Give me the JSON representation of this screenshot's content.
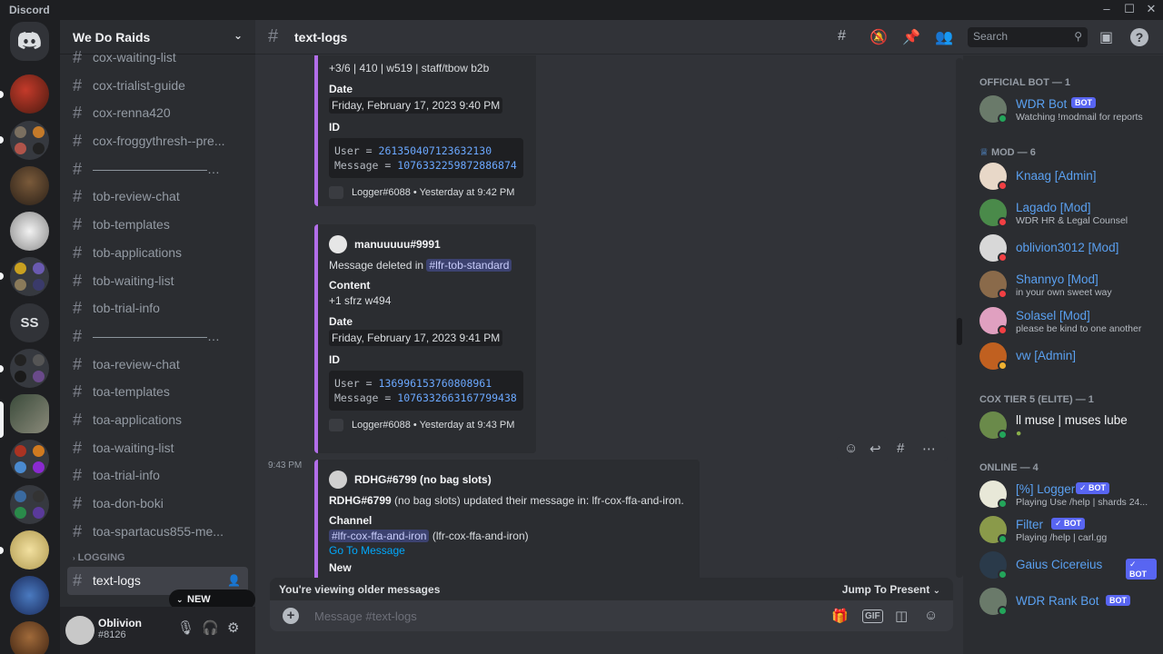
{
  "app": {
    "title": "Discord"
  },
  "server": {
    "name": "We Do Raids",
    "home_initials": "SS"
  },
  "channels": [
    "cox-waiting-list",
    "cox-trialist-guide",
    "cox-renna420",
    "cox-froggythresh--pre...",
    "——————————...",
    "tob-review-chat",
    "tob-templates",
    "tob-applications",
    "tob-waiting-list",
    "tob-trial-info",
    "——————————...",
    "toa-review-chat",
    "toa-templates",
    "toa-applications",
    "toa-waiting-list",
    "toa-trial-info",
    "toa-don-boki",
    "toa-spartacus855-me..."
  ],
  "category": "LOGGING",
  "active_channel": "text-logs",
  "new_unreads": "NEW UNREADS",
  "user": {
    "name": "Oblivion",
    "tag": "#8126"
  },
  "header": {
    "channel": "text-logs",
    "search_placeholder": "Search"
  },
  "messages": {
    "embed1": {
      "content": "+3/6 | 410 | w519 | staff/tbow b2b",
      "date_label": "Date",
      "date": "Friday, February 17, 2023 9:40 PM",
      "id_label": "ID",
      "user_key": "User",
      "user_id": "261350407123632130",
      "message_key": "Message",
      "message_id": "1076332259872886874",
      "footer": "Logger#6088 • Yesterday at 9:42 PM"
    },
    "embed2": {
      "author": "manuuuuu#9991",
      "deleted_prefix": "Message deleted in",
      "deleted_channel": "#lfr-tob-standard",
      "content_label": "Content",
      "content": "+1 sfrz w494",
      "date_label": "Date",
      "date": "Friday, February 17, 2023 9:41 PM",
      "id_label": "ID",
      "user_key": "User",
      "user_id": "136996153760808961",
      "message_key": "Message",
      "message_id": "1076332663167799438",
      "footer": "Logger#6088 • Yesterday at 9:43 PM"
    },
    "embed3": {
      "timestamp": "9:43 PM",
      "author": "RDHG#6799 (no bag slots)",
      "update_bold": "RDHG#6799",
      "update_text": "(no bag slots) updated their message in: lfr-cox-ffa-and-iron.",
      "channel_label": "Channel",
      "channel_mention": "#lfr-cox-ffa-and-iron",
      "channel_text": "(lfr-cox-ffa-and-iron)",
      "goto": "Go To Message",
      "new_label": "New"
    }
  },
  "older_bar": {
    "text": "You're viewing older messages",
    "jump": "Jump To Present"
  },
  "composer": {
    "placeholder": "Message #text-logs"
  },
  "members": {
    "official_bot_header": "OFFICIAL BOT — 1",
    "mod_header": "MOD — 6",
    "cox_header": "COX TIER 5 (ELITE) — 1",
    "online_header": "ONLINE — 4",
    "bot_badge": "BOT",
    "list": [
      {
        "name": "WDR Bot",
        "sub": "Watching !modmail for reports",
        "color": "#5aa0f0"
      },
      {
        "name": "Knaag [Admin]",
        "sub": "",
        "color": "#5aa0f0"
      },
      {
        "name": "Lagado [Mod]",
        "sub": "WDR HR & Legal Counsel",
        "color": "#5aa0f0"
      },
      {
        "name": "oblivion3012 [Mod]",
        "sub": "",
        "color": "#5aa0f0"
      },
      {
        "name": "Shannyo [Mod]",
        "sub": "in your own sweet way",
        "color": "#5aa0f0"
      },
      {
        "name": "Solasel [Mod]",
        "sub": "please be kind to one another",
        "color": "#5aa0f0"
      },
      {
        "name": "vw [Admin]",
        "sub": "",
        "color": "#5aa0f0"
      },
      {
        "name": "ll muse | muses lube",
        "sub": "",
        "color": "#f2f3f5"
      },
      {
        "name": "[%] Logger",
        "sub": "Playing Use /help | shards 24...",
        "color": "#5aa0f0"
      },
      {
        "name": "Filter",
        "sub": "Playing /help | carl.gg",
        "color": "#5aa0f0"
      },
      {
        "name": "Gaius Cicereius",
        "sub": "",
        "color": "#5aa0f0"
      },
      {
        "name": "WDR Rank Bot",
        "sub": "",
        "color": "#5aa0f0"
      }
    ]
  }
}
